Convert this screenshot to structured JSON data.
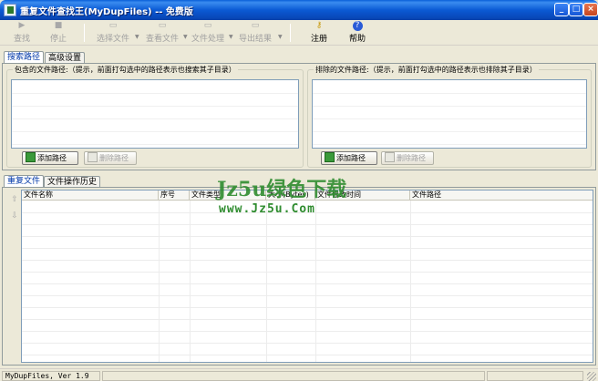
{
  "window": {
    "title": "重复文件查找王(MyDupFiles) -- 免费版",
    "min_label": "_",
    "max_label": "□",
    "close_label": "×"
  },
  "toolbar": {
    "find": "查找",
    "stop": "停止",
    "select_file": "选择文件",
    "view_file": "查看文件",
    "file_process": "文件处理",
    "export_result": "导出结果",
    "register": "注册",
    "help": "帮助"
  },
  "tabs": {
    "search_path": "搜索路径",
    "advanced": "高级设置"
  },
  "include": {
    "title": "包含的文件路径:（提示，前面打勾选中的路径表示也搜索其子目录）",
    "add_button": "添加路径",
    "delete_button": "删除路径"
  },
  "exclude": {
    "title": "排除的文件路径:（提示，前面打勾选中的路径表示也排除其子目录）",
    "add_button": "添加路径",
    "delete_button": "删除路径"
  },
  "result_tabs": {
    "dup_files": "重复文件",
    "history": "文件操作历史"
  },
  "grid": {
    "columns": [
      "文件名称",
      "序号",
      "文件类型",
      "大小(Bytes)",
      "文件修改时间",
      "文件路径"
    ]
  },
  "watermark": {
    "line1": "Jz5u绿色下载",
    "line2": "www.Jz5u.Com"
  },
  "status": {
    "version": "MyDupFiles, Ver 1.9"
  }
}
